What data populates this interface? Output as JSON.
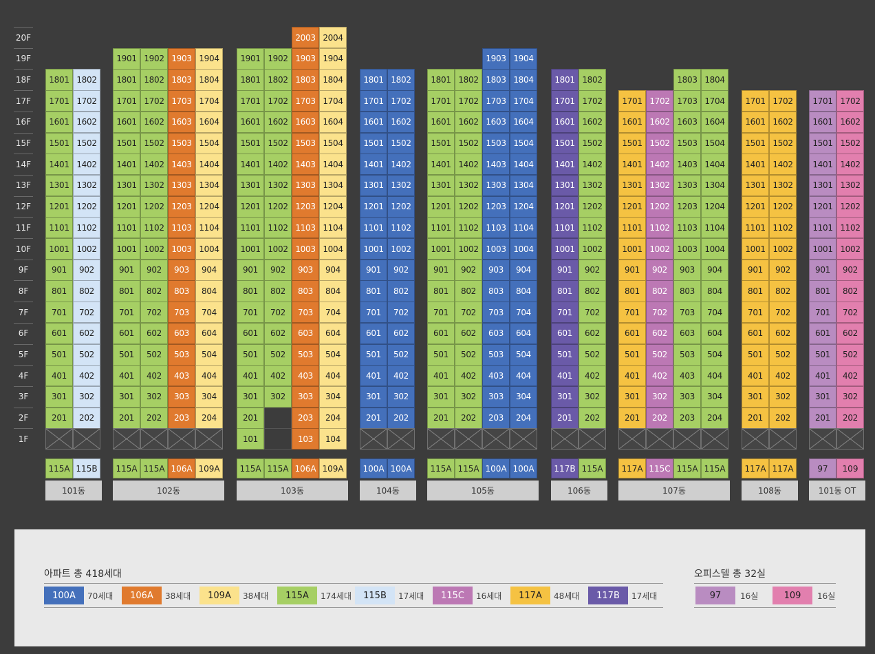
{
  "colors": {
    "100A": "#4470bb",
    "106A": "#e07a2e",
    "109A": "#fbe28c",
    "115A": "#a6cf64",
    "115B": "#d3e4f6",
    "115C": "#bc78b4",
    "117A": "#f5c242",
    "117B": "#6a5aa8",
    "97": "#b98cc1",
    "109": "#e27fae"
  },
  "floors": [
    "20F",
    "19F",
    "18F",
    "17F",
    "16F",
    "15F",
    "14F",
    "13F",
    "12F",
    "11F",
    "10F",
    "9F",
    "8F",
    "7F",
    "6F",
    "5F",
    "4F",
    "3F",
    "2F",
    "1F"
  ],
  "buildings": [
    {
      "name": "101동",
      "types": [
        "115A",
        "115B"
      ],
      "tops": [
        18,
        18
      ],
      "first": [
        "x",
        "x"
      ],
      "gaps": []
    },
    {
      "name": "102동",
      "types": [
        "115A",
        "115A",
        "106A",
        "109A"
      ],
      "tops": [
        19,
        19,
        19,
        19
      ],
      "first": [
        "x",
        "x",
        "x",
        "x"
      ],
      "gaps": []
    },
    {
      "name": "103동",
      "types": [
        "115A",
        "115A",
        "106A",
        "109A"
      ],
      "tops": [
        19,
        19,
        20,
        20
      ],
      "first": [
        "101",
        "dark",
        "103",
        "104"
      ],
      "gaps": [
        [
          1,
          2
        ]
      ]
    },
    {
      "name": "104동",
      "types": [
        "100A",
        "100A"
      ],
      "tops": [
        18,
        18
      ],
      "first": [
        "x",
        "x"
      ],
      "gaps": []
    },
    {
      "name": "105동",
      "types": [
        "115A",
        "115A",
        "100A",
        "100A"
      ],
      "tops": [
        18,
        18,
        19,
        19
      ],
      "first": [
        "x",
        "x",
        "x",
        "x"
      ],
      "gaps": []
    },
    {
      "name": "106동",
      "types": [
        "117B",
        "115A"
      ],
      "tops": [
        18,
        18
      ],
      "first": [
        "x",
        "x"
      ],
      "gaps": []
    },
    {
      "name": "107동",
      "types": [
        "117A",
        "115C",
        "115A",
        "115A"
      ],
      "tops": [
        17,
        17,
        18,
        18
      ],
      "first": [
        "x",
        "x",
        "x",
        "x"
      ],
      "gaps": []
    },
    {
      "name": "108동",
      "types": [
        "117A",
        "117A"
      ],
      "tops": [
        17,
        17
      ],
      "first": [
        "x",
        "x"
      ],
      "gaps": []
    },
    {
      "name": "101동 OT",
      "types": [
        "97",
        "109"
      ],
      "tops": [
        17,
        17
      ],
      "first": [
        "x",
        "x"
      ],
      "gaps": []
    }
  ],
  "legend": {
    "apt_title": "아파트 총 418세대",
    "apt_items": [
      {
        "type": "100A",
        "count": "70세대"
      },
      {
        "type": "106A",
        "count": "38세대"
      },
      {
        "type": "109A",
        "count": "38세대"
      },
      {
        "type": "115A",
        "count": "174세대"
      },
      {
        "type": "115B",
        "count": "17세대"
      },
      {
        "type": "115C",
        "count": "16세대"
      },
      {
        "type": "117A",
        "count": "48세대"
      },
      {
        "type": "117B",
        "count": "17세대"
      }
    ],
    "ot_title": "오피스텔 총 32실",
    "ot_items": [
      {
        "type": "97",
        "count": "16실"
      },
      {
        "type": "109",
        "count": "16실"
      }
    ]
  }
}
